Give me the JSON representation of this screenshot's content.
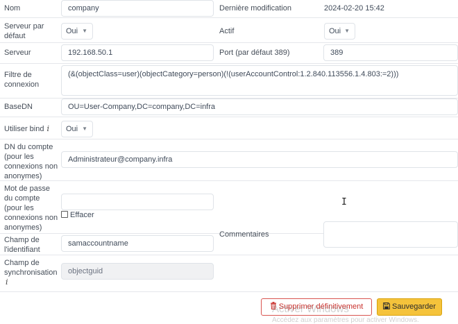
{
  "labels": {
    "nom": "Nom",
    "derniere_modif": "Dernière modification",
    "serveur_defaut": "Serveur par défaut",
    "actif": "Actif",
    "serveur": "Serveur",
    "port": "Port (par défaut 389)",
    "filtre": "Filtre de connexion",
    "basedn": "BaseDN",
    "utiliser_bind": "Utiliser bind",
    "dn_compte": "DN du compte (pour les connexions non anonymes)",
    "mdp_compte": "Mot de passe du compte (pour les connexions non anonymes)",
    "champ_identifiant": "Champ de l'identifiant",
    "commentaires": "Commentaires",
    "champ_sync": "Champ de synchronisation"
  },
  "values": {
    "nom": "company",
    "derniere_modif": "2024-02-20 15:42",
    "serveur_defaut": "Oui",
    "actif": "Oui",
    "serveur": "192.168.50.1",
    "port": "389",
    "filtre": "(&(objectClass=user)(objectCategory=person)(!(userAccountControl:1.2.840.113556.1.4.803:=2)))",
    "basedn": "OU=User-Company,DC=company,DC=infra",
    "utiliser_bind": "Oui",
    "dn_compte": "Administrateur@company.infra",
    "mdp_compte": "",
    "champ_identifiant": "samaccountname",
    "commentaires": "",
    "champ_sync": "objectguid"
  },
  "checkbox": {
    "effacer": "Effacer"
  },
  "buttons": {
    "delete": "Supprimer définitivement",
    "save": "Sauvegarder"
  },
  "watermark": {
    "line1": "Activer Windows",
    "line2": "Accédez aux paramètres pour activer Windows."
  },
  "icons": {
    "info": "info-icon",
    "trash": "trash-icon",
    "save": "save-icon",
    "caret": "chevron-down-icon"
  },
  "colors": {
    "danger": "#d9534f",
    "warning": "#f5c33b"
  }
}
